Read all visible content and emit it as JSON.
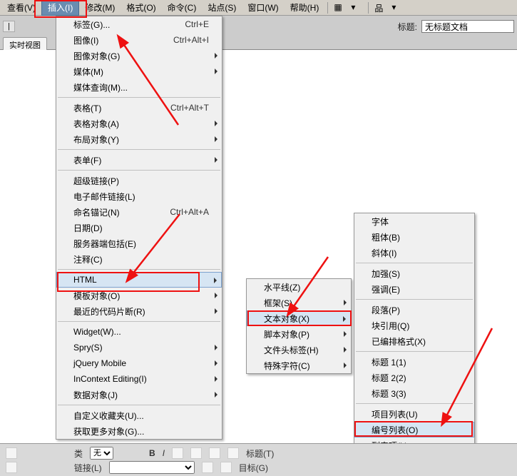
{
  "menubar": {
    "items": [
      "查看(V)",
      "插入(I)",
      "修改(M)",
      "格式(O)",
      "命令(C)",
      "站点(S)",
      "窗口(W)",
      "帮助(H)"
    ],
    "activeIndex": 1
  },
  "toolbar": {
    "tab_realtime": "实时视图",
    "title_label": "标题:",
    "title_value": "无标题文档"
  },
  "insert_menu": [
    {
      "label": "标签(G)...",
      "shortcut": "Ctrl+E"
    },
    {
      "label": "图像(I)",
      "shortcut": "Ctrl+Alt+I"
    },
    {
      "label": "图像对象(G)",
      "sub": true
    },
    {
      "label": "媒体(M)",
      "sub": true
    },
    {
      "label": "媒体查询(M)..."
    },
    {
      "sep": true
    },
    {
      "label": "表格(T)",
      "shortcut": "Ctrl+Alt+T"
    },
    {
      "label": "表格对象(A)",
      "sub": true
    },
    {
      "label": "布局对象(Y)",
      "sub": true
    },
    {
      "sep": true
    },
    {
      "label": "表单(F)",
      "sub": true
    },
    {
      "sep": true
    },
    {
      "label": "超级链接(P)"
    },
    {
      "label": "电子邮件链接(L)"
    },
    {
      "label": "命名锚记(N)",
      "shortcut": "Ctrl+Alt+A"
    },
    {
      "label": "日期(D)"
    },
    {
      "label": "服务器端包括(E)"
    },
    {
      "label": "注释(C)"
    },
    {
      "sep": true
    },
    {
      "label": "HTML",
      "sub": true,
      "highlight": true
    },
    {
      "label": "模板对象(O)",
      "sub": true
    },
    {
      "label": "最近的代码片断(R)",
      "sub": true
    },
    {
      "sep": true
    },
    {
      "label": "Widget(W)..."
    },
    {
      "label": "Spry(S)",
      "sub": true
    },
    {
      "label": "jQuery Mobile",
      "sub": true
    },
    {
      "label": "InContext Editing(I)",
      "sub": true
    },
    {
      "label": "数据对象(J)",
      "sub": true
    },
    {
      "sep": true
    },
    {
      "label": "自定义收藏夹(U)..."
    },
    {
      "label": "获取更多对象(G)..."
    }
  ],
  "html_submenu": [
    {
      "label": "水平线(Z)"
    },
    {
      "label": "框架(S)",
      "sub": true
    },
    {
      "label": "文本对象(X)",
      "sub": true,
      "highlight": true
    },
    {
      "label": "脚本对象(P)",
      "sub": true
    },
    {
      "label": "文件头标签(H)",
      "sub": true
    },
    {
      "label": "特殊字符(C)",
      "sub": true
    }
  ],
  "text_submenu": [
    {
      "label": "字体"
    },
    {
      "label": "粗体(B)"
    },
    {
      "label": "斜体(I)"
    },
    {
      "sep": true
    },
    {
      "label": "加强(S)"
    },
    {
      "label": "强调(E)"
    },
    {
      "sep": true
    },
    {
      "label": "段落(P)"
    },
    {
      "label": "块引用(Q)"
    },
    {
      "label": "已编排格式(X)"
    },
    {
      "sep": true
    },
    {
      "label": "标题 1(1)"
    },
    {
      "label": "标题 2(2)"
    },
    {
      "label": "标题 3(3)"
    },
    {
      "sep": true
    },
    {
      "label": "项目列表(U)"
    },
    {
      "label": "编号列表(O)",
      "highlight": true
    },
    {
      "label": "列表项(L)"
    }
  ],
  "bottombar": {
    "class_label": "类",
    "class_value": "无",
    "link_label": "链接(L)",
    "title_label": "标题(T)",
    "target_label": "目标(G)"
  }
}
